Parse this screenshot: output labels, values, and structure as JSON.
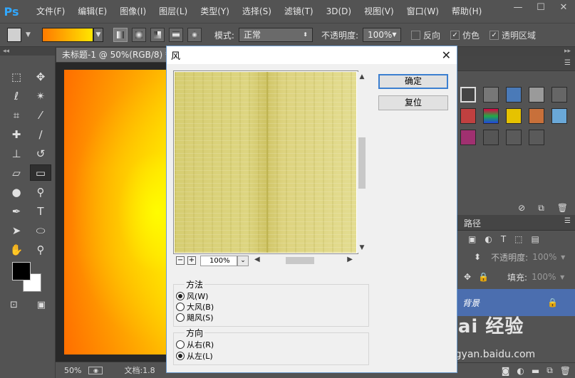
{
  "menubar": {
    "logo": "Ps",
    "items": [
      "文件(F)",
      "编辑(E)",
      "图像(I)",
      "图层(L)",
      "类型(Y)",
      "选择(S)",
      "滤镜(T)",
      "3D(D)",
      "视图(V)",
      "窗口(W)",
      "帮助(H)"
    ],
    "window_controls": [
      "—",
      "☐",
      "✕"
    ]
  },
  "options_bar": {
    "mode_label": "模式:",
    "mode_value": "正常",
    "opacity_label": "不透明度:",
    "opacity_value": "100%",
    "reverse_label": "反向",
    "reverse_checked": false,
    "dither_label": "仿色",
    "dither_checked": true,
    "transparency_label": "透明区域",
    "transparency_checked": true
  },
  "document": {
    "tab_title": "未标题-1 @ 50%(RGB/8) *",
    "zoom": "50%",
    "doc_info": "文档:1.8"
  },
  "right_panel": {
    "paths_tab": "路径",
    "opacity_label": "不透明度:",
    "opacity_value": "100%",
    "fill_label": "填充:",
    "fill_value": "100%",
    "layer_name": "背景"
  },
  "dialog": {
    "title": "风",
    "ok_label": "确定",
    "reset_label": "复位",
    "zoom_value": "100%",
    "method_title": "方法",
    "method_options": [
      "风(W)",
      "大风(B)",
      "飓风(S)"
    ],
    "method_selected": 0,
    "direction_title": "方向",
    "direction_options": [
      "从右(R)",
      "从左(L)"
    ],
    "direction_selected": 1
  },
  "watermark": {
    "brand": "Bai 经验",
    "url": "jingyan.baidu.com"
  },
  "colors": {
    "ui_dark": "#535353",
    "gradient_start": "#ff7a00",
    "gradient_end": "#fff000",
    "dialog_accent": "#3c7fd0",
    "layer_selected": "#4b6eaf"
  }
}
